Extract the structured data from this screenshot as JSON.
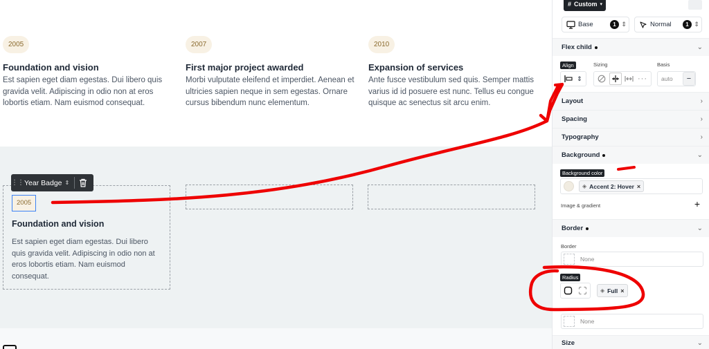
{
  "canvas": {
    "cards": [
      {
        "year": "2005",
        "title": "Foundation and vision",
        "body": "Est sapien eget diam egestas. Dui libero quis gravida velit. Adipiscing in odio non at eros lobortis etiam. Nam euismod consequat."
      },
      {
        "year": "2007",
        "title": "First major project awarded",
        "body": "Morbi vulputate eleifend et imperdiet. Aenean et ultricies sapien neque in sem egestas. Ornare cursus bibendum nunc elementum."
      },
      {
        "year": "2010",
        "title": "Expansion of services",
        "body": "Ante fusce vestibulum sed quis. Semper mattis varius id id posuere est nunc. Tellus eu congue quisque ac senectus sit arcu enim."
      }
    ],
    "selected_card": {
      "year": "2005",
      "title": "Foundation and vision",
      "body": "Est sapien eget diam egestas. Dui libero quis gravida velit. Adipiscing in odio non at eros lobortis etiam. Nam euismod consequat."
    },
    "toolbar": {
      "element_label": "Year Badge",
      "grip_icon": "drag-handle-icon",
      "chevron_icon": "chevron-up-down-icon",
      "delete_icon": "trash-icon"
    }
  },
  "panel": {
    "class_tag": {
      "hash": "#",
      "label": "Custom"
    },
    "breakpoint": {
      "label": "Base",
      "count": "1",
      "icon": "monitor-icon"
    },
    "state": {
      "label": "Normal",
      "count": "1",
      "icon": "cursor-icon"
    },
    "sections": {
      "flex_child": "Flex child",
      "layout": "Layout",
      "spacing": "Spacing",
      "typography": "Typography",
      "background": "Background",
      "border": "Border",
      "size": "Size"
    },
    "flex_child": {
      "align_label": "Align",
      "sizing_label": "Sizing",
      "basis_label": "Basis",
      "basis_placeholder": "auto",
      "minus_symbol": "−"
    },
    "background": {
      "color_label": "Background color",
      "variable_value": "Accent 2: Hover",
      "swatch_color": "#f1ece1",
      "image_label": "Image & gradient",
      "add_symbol": "+"
    },
    "border": {
      "border_label": "Border",
      "border_value": "None",
      "radius_label": "Radius",
      "radius_value": "Full",
      "shadow_value": "None"
    }
  },
  "colors": {
    "accent_blue": "#3b82f6",
    "badge_bg": "#f8f1e4",
    "badge_text": "#8a6a2e",
    "annotation_red": "#ee0000"
  }
}
